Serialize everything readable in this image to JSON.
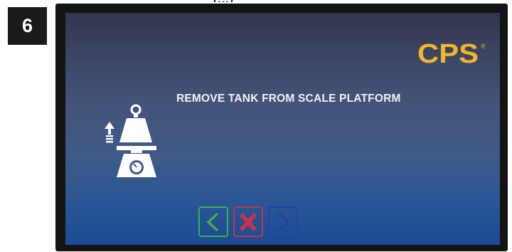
{
  "step": {
    "number": "6"
  },
  "header": {
    "partial_title": "(...)"
  },
  "screen": {
    "logo": {
      "text": "CPS",
      "registered_mark": "®",
      "color": "#f2b52b"
    },
    "message": "REMOVE TANK FROM SCALE PLATFORM",
    "icon": "remove-tank-from-scale-icon",
    "nav": {
      "back": {
        "icon": "chevron-left-icon",
        "color": "#3fae4e"
      },
      "cancel": {
        "icon": "x-icon",
        "color": "#c8334a"
      },
      "next": {
        "icon": "chevron-right-icon",
        "color": "#2740a8"
      }
    }
  }
}
